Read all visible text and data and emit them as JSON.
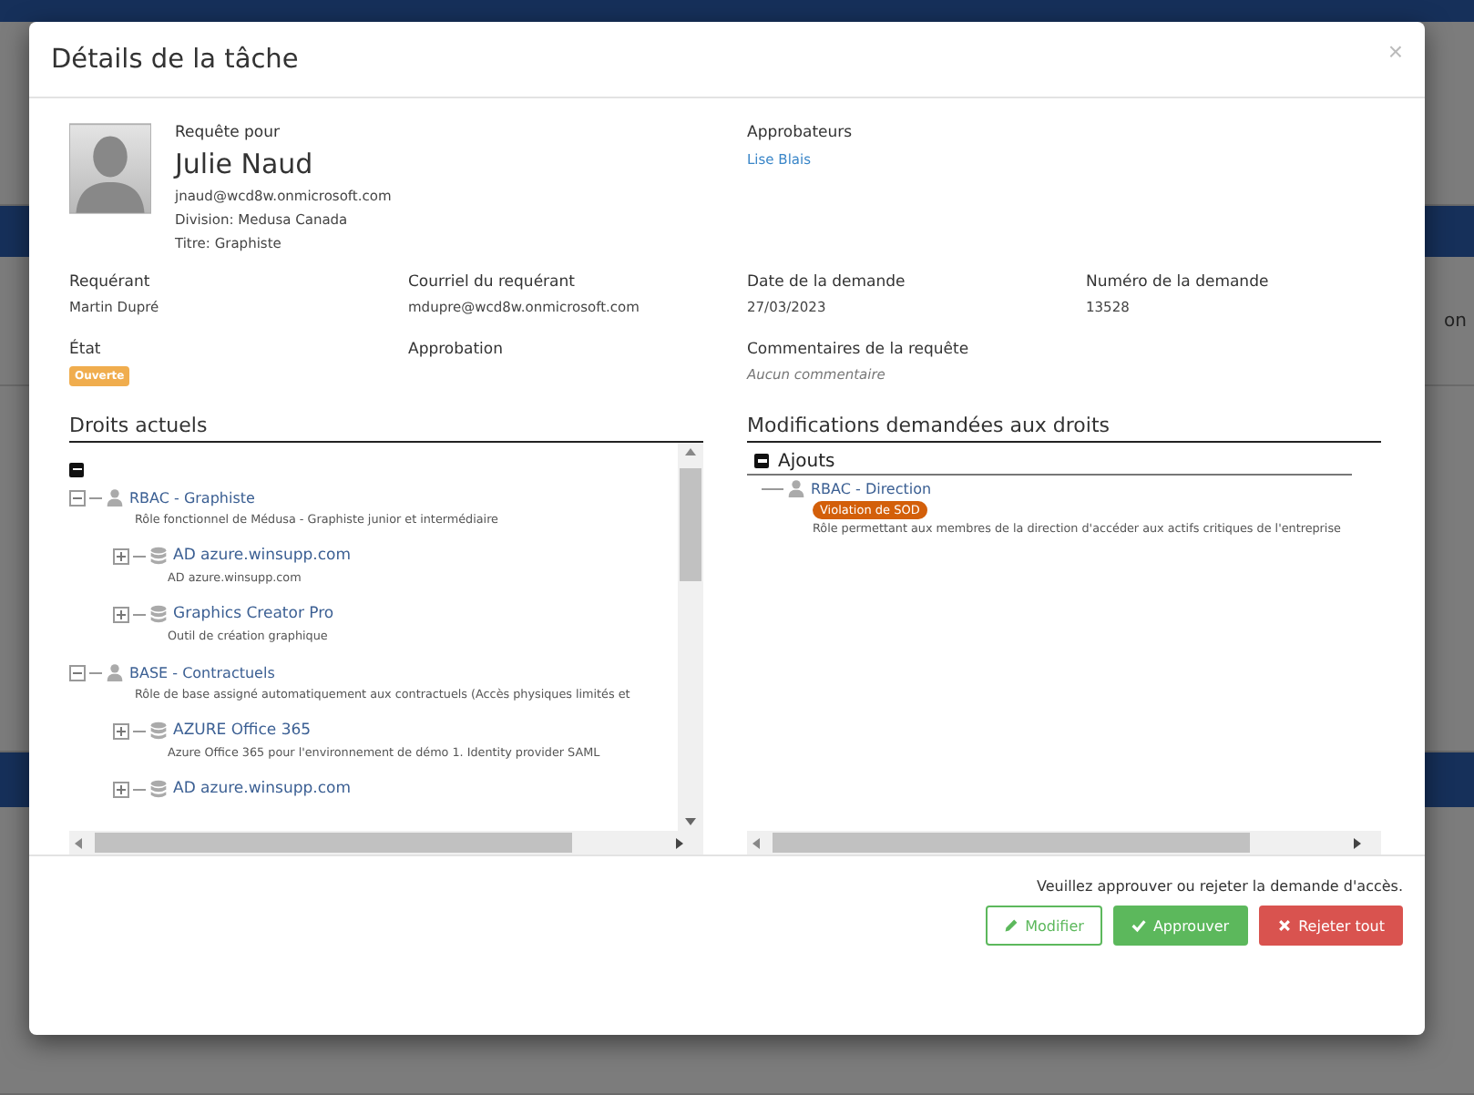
{
  "background_fragment": "on",
  "dialog": {
    "title": "Détails de la tâche",
    "close": "×"
  },
  "request_for": {
    "label": "Requête pour",
    "name": "Julie Naud",
    "email": "jnaud@wcd8w.onmicrosoft.com",
    "division": "Division: Medusa Canada",
    "title": "Titre: Graphiste"
  },
  "approvers": {
    "label": "Approbateurs",
    "names": [
      "Lise Blais"
    ]
  },
  "fields": [
    {
      "label": "Requérant",
      "value": "Martin Dupré",
      "kind": "text"
    },
    {
      "label": "Courriel du requérant",
      "value": "mdupre@wcd8w.onmicrosoft.com",
      "kind": "text"
    },
    {
      "label": "Date de la demande",
      "value": "27/03/2023",
      "kind": "text"
    },
    {
      "label": "Numéro de la demande",
      "value": "13528",
      "kind": "text"
    },
    {
      "label": "État",
      "value": "Ouverte",
      "kind": "badge"
    },
    {
      "label": "Approbation",
      "kind": "empty"
    },
    {
      "label": "Commentaires de la requête",
      "value": "Aucun commentaire",
      "kind": "note"
    }
  ],
  "current_rights": {
    "title": "Droits actuels",
    "tree": {
      "expanded": true,
      "children": [
        {
          "label": "RBAC - Graphiste",
          "kind": "role",
          "expanded": true,
          "description": "Rôle fonctionnel de Médusa - Graphiste junior et intermédiaire",
          "children": [
            {
              "label": "AD azure.winsupp.com",
              "kind": "resource",
              "expanded": false,
              "description": "AD azure.winsupp.com"
            },
            {
              "label": "Graphics Creator Pro",
              "kind": "resource",
              "expanded": false,
              "description": "Outil de création graphique"
            }
          ]
        },
        {
          "label": "BASE - Contractuels",
          "kind": "role",
          "expanded": true,
          "description": "Rôle de base assigné automatiquement aux contractuels (Accès physiques limités et",
          "children": [
            {
              "label": "AZURE Office 365",
              "kind": "resource",
              "expanded": false,
              "description": "Azure Office 365 pour l'environnement de démo 1. Identity provider SAML"
            },
            {
              "label": "AD azure.winsupp.com",
              "kind": "resource",
              "expanded": false
            }
          ]
        }
      ]
    }
  },
  "requested_changes": {
    "title": "Modifications demandées aux droits",
    "groups": [
      {
        "label": "Ajouts",
        "expanded": true,
        "items": [
          {
            "label": "RBAC - Direction",
            "kind": "role",
            "badge": "Violation de SOD",
            "description": "Rôle permettant aux membres de la direction d'accéder aux actifs critiques de l'entreprise"
          }
        ]
      }
    ]
  },
  "footer": {
    "message": "Veuillez approuver ou rejeter la demande d'accès.",
    "buttons": [
      {
        "label": "Modifier",
        "kind": "edit"
      },
      {
        "label": "Approuver",
        "kind": "approve"
      },
      {
        "label": "Rejeter tout",
        "kind": "reject"
      }
    ]
  }
}
